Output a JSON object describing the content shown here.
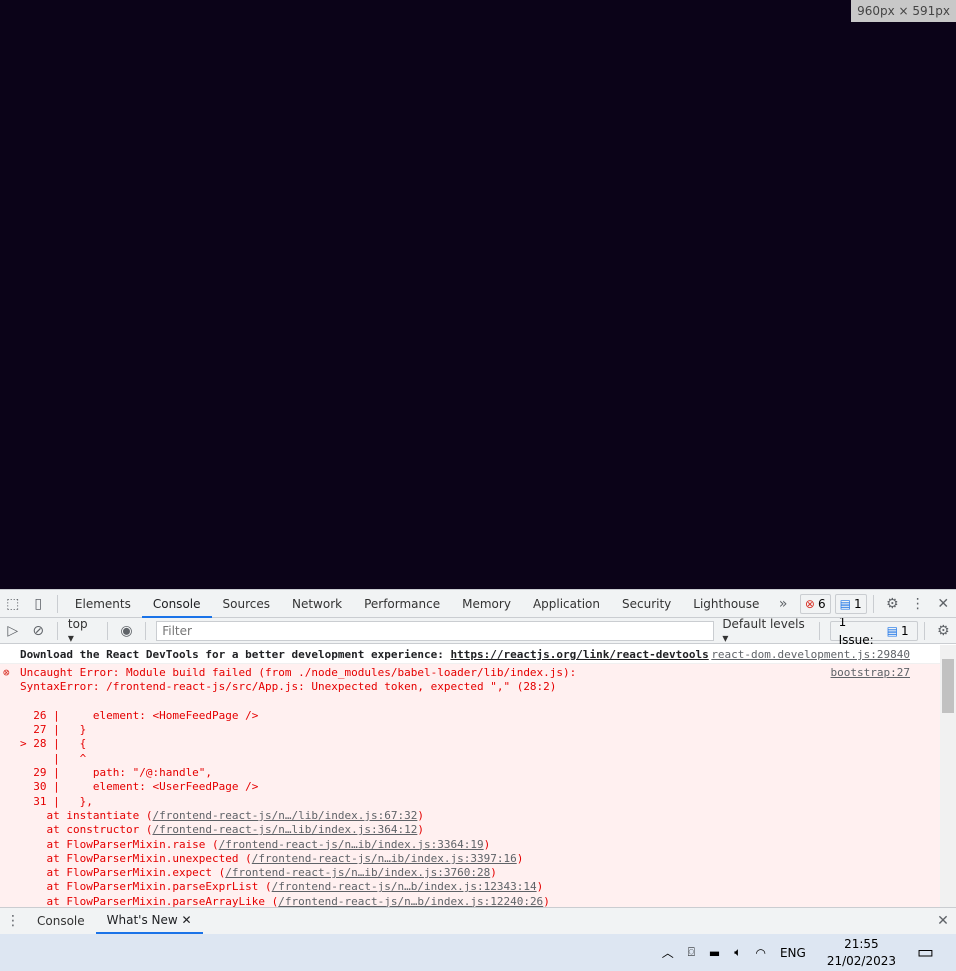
{
  "viewport_size": "960px × 591px",
  "devtools": {
    "tabs": [
      "Elements",
      "Console",
      "Sources",
      "Network",
      "Performance",
      "Memory",
      "Application",
      "Security",
      "Lighthouse"
    ],
    "active_tab": "Console",
    "error_count": "6",
    "message_count": "1",
    "toolbar": {
      "context": "top",
      "filter_placeholder": "Filter",
      "levels": "Default levels",
      "issues_label": "1 Issue:",
      "issues_count": "1"
    },
    "messages": {
      "info_text": "Download the React DevTools for a better development experience: ",
      "info_link": "https://reactjs.org/link/react-devtools",
      "info_source": "react-dom.development.js:29840",
      "error_line1": "Uncaught Error: Module build failed (from ./node_modules/babel-loader/lib/index.js):",
      "error_line2": "SyntaxError: /frontend-react-js/src/App.js: Unexpected token, expected \",\" (28:2)",
      "error_source": "bootstrap:27",
      "code": [
        "",
        "  26 |     element: <HomeFeedPage />",
        "  27 |   }",
        "> 28 |   {",
        "     |   ^",
        "  29 |     path: \"/@:handle\",",
        "  30 |     element: <UserFeedPage />",
        "  31 |   },"
      ],
      "stack": [
        {
          "fn": "    at instantiate (",
          "loc": "/frontend-react-js/n…/lib/index.js:67:32"
        },
        {
          "fn": "    at constructor (",
          "loc": "/frontend-react-js/n…lib/index.js:364:12"
        },
        {
          "fn": "    at FlowParserMixin.raise (",
          "loc": "/frontend-react-js/n…ib/index.js:3364:19"
        },
        {
          "fn": "    at FlowParserMixin.unexpected (",
          "loc": "/frontend-react-js/n…ib/index.js:3397:16"
        },
        {
          "fn": "    at FlowParserMixin.expect (",
          "loc": "/frontend-react-js/n…ib/index.js:3760:28"
        },
        {
          "fn": "    at FlowParserMixin.parseExprList (",
          "loc": "/frontend-react-js/n…b/index.js:12343:14"
        },
        {
          "fn": "    at FlowParserMixin.parseArrayLike (",
          "loc": "/frontend-react-js/n…b/index.js:12240:26"
        }
      ]
    },
    "drawer_tabs": [
      "Console",
      "What's New"
    ]
  },
  "taskbar": {
    "lang": "ENG",
    "time": "21:55",
    "date": "21/02/2023"
  }
}
